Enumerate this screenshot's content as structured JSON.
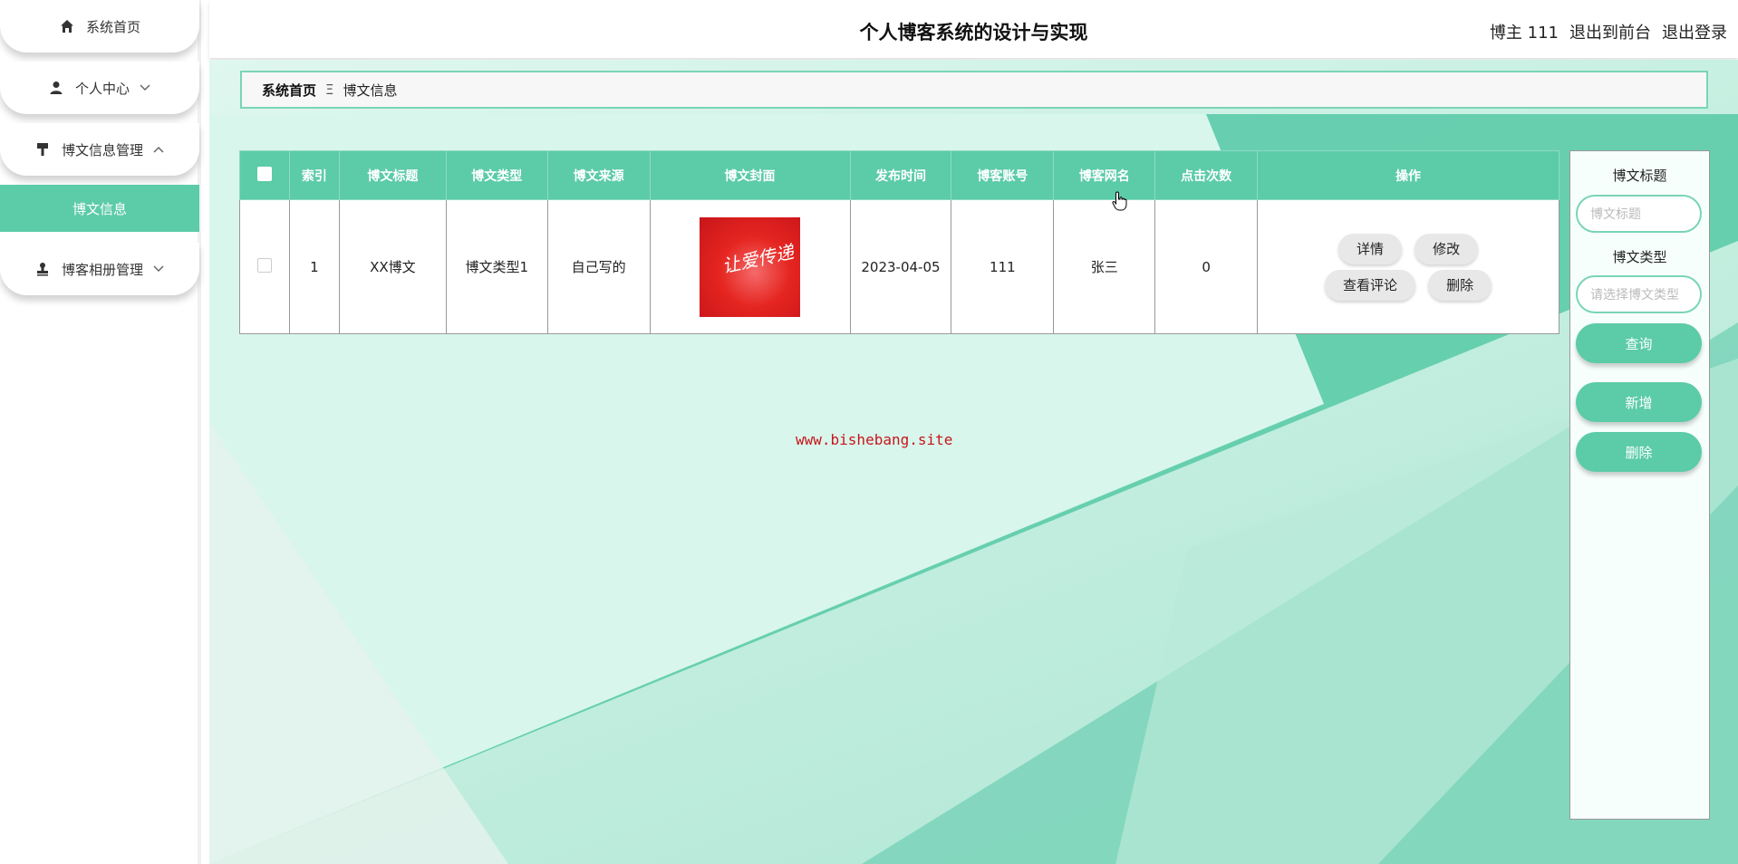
{
  "app": {
    "title": "个人博客系统的设计与实现",
    "user": {
      "role_name": "博主 111",
      "back_front": "退出到前台",
      "logout": "退出登录"
    }
  },
  "sidebar": {
    "items": [
      {
        "label": "系统首页",
        "icon": "home-icon"
      },
      {
        "label": "个人中心",
        "icon": "user-icon",
        "chevron": "down"
      },
      {
        "label": "博文信息管理",
        "icon": "brush-icon",
        "chevron": "up"
      },
      {
        "label": "博客相册管理",
        "icon": "stamp-icon",
        "chevron": "down"
      }
    ],
    "submenu": {
      "label": "博文信息"
    },
    "accent": "#5ccba8"
  },
  "breadcrumb": {
    "home": "系统首页",
    "separator": "Ξ",
    "current": "博文信息"
  },
  "table": {
    "headers": [
      "索引",
      "博文标题",
      "博文类型",
      "博文来源",
      "博文封面",
      "发布时间",
      "博客账号",
      "博客网名",
      "点击次数",
      "操作"
    ],
    "rows": [
      {
        "index": "1",
        "title": "XX博文",
        "type": "博文类型1",
        "source": "自己写的",
        "cover_text": "让爱传递",
        "date": "2023-04-05",
        "account": "111",
        "nickname": "张三",
        "clicks": "0",
        "actions": {
          "detail": "详情",
          "edit": "修改",
          "comments": "查看评论",
          "delete": "删除"
        }
      }
    ]
  },
  "filter": {
    "title_label": "博文标题",
    "title_placeholder": "博文标题",
    "type_label": "博文类型",
    "type_placeholder": "请选择博文类型",
    "search": "查询",
    "add": "新增",
    "delete": "删除"
  },
  "watermark": "www.bishebang.site"
}
